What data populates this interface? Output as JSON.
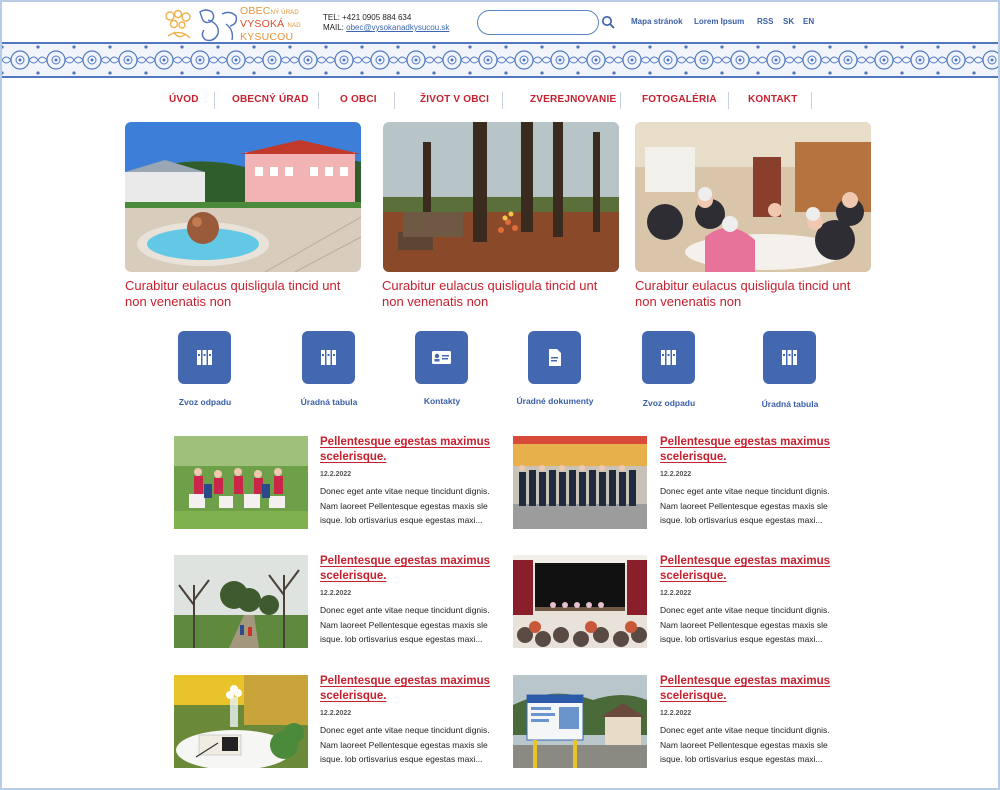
{
  "header": {
    "logo_top": "OBEC",
    "logo_top_small": "NÝ ÚRAD",
    "logo_mid": "VYSOKÁ",
    "logo_mid_small": "NAD",
    "logo_bottom": "KYSUCOU",
    "tel": "TEL: +421 0905 884 634",
    "mail_label": "MAIL: ",
    "mail": "obec@vysokanadkysucou.sk",
    "search_placeholder": "",
    "links": [
      "Mapa stránok",
      "Lorem Ipsum",
      "RSS",
      "SK",
      "EN"
    ]
  },
  "nav": [
    "ÚVOD",
    "OBECNÝ ÚRAD",
    "O OBCI",
    "ŽIVOT V OBCI",
    "ZVEREJNOVANIE",
    "FOTOGALÉRIA",
    "KONTAKT"
  ],
  "hero": [
    {
      "caption": "Curabitur eulacus quisligula tincid unt non venenatis non"
    },
    {
      "caption": "Curabitur eulacus quisligula tincid unt non venenatis non"
    },
    {
      "caption": "Curabitur eulacus quisligula tincid unt non venenatis non"
    }
  ],
  "quick_links": [
    {
      "label": "Zvoz odpadu",
      "icon": "binders-icon"
    },
    {
      "label": "Úradná tabula",
      "icon": "binders-icon"
    },
    {
      "label": "Kontakty",
      "icon": "contact-card-icon"
    },
    {
      "label": "Úradné dokumenty",
      "icon": "document-icon"
    },
    {
      "label": "Zvoz odpadu",
      "icon": "binders-icon"
    },
    {
      "label": "Úradná tabula",
      "icon": "binders-icon"
    }
  ],
  "news": [
    {
      "title": "Pellentesque egestas maximus scelerisque.",
      "date": "12.2.2022",
      "excerpt": "Donec eget ante vitae neque tincidunt dignis. Nam laoreet Pellentesque egestas maxis sle isque. lob ortisvarius esque egestas maxi..."
    },
    {
      "title": "Pellentesque egestas maximus scelerisque.",
      "date": "12.2.2022",
      "excerpt": "Donec eget ante vitae neque tincidunt dignis. Nam laoreet Pellentesque egestas maxis sle isque. lob ortisvarius esque egestas maxi..."
    },
    {
      "title": "Pellentesque egestas maximus scelerisque.",
      "date": "12.2.2022",
      "excerpt": "Donec eget ante vitae neque tincidunt dignis. Nam laoreet Pellentesque egestas maxis sle isque. lob ortisvarius esque egestas maxi..."
    },
    {
      "title": "Pellentesque egestas maximus scelerisque.",
      "date": "12.2.2022",
      "excerpt": "Donec eget ante vitae neque tincidunt dignis. Nam laoreet Pellentesque egestas maxis sle isque. lob ortisvarius esque egestas maxi..."
    },
    {
      "title": "Pellentesque egestas maximus scelerisque.",
      "date": "12.2.2022",
      "excerpt": "Donec eget ante vitae neque tincidunt dignis. Nam laoreet Pellentesque egestas maxis sle isque. lob ortisvarius esque egestas maxi..."
    },
    {
      "title": "Pellentesque egestas maximus scelerisque.",
      "date": "12.2.2022",
      "excerpt": "Donec eget ante vitae neque tincidunt dignis. Nam laoreet Pellentesque egestas maxis sle isque. lob ortisvarius esque egestas maxi..."
    }
  ],
  "colors": {
    "accent_red": "#c7202f",
    "accent_blue": "#4468b0",
    "logo_orange": "#e6923a"
  }
}
